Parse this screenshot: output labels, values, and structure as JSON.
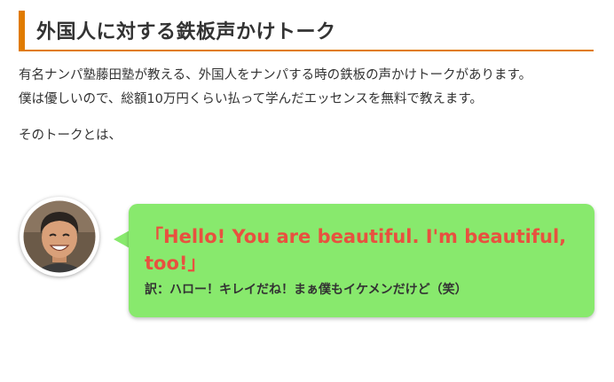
{
  "section": {
    "heading": "外国人に対する鉄板声かけトーク",
    "accent_color": "#e07b00"
  },
  "body": {
    "paragraph1_line1": "有名ナンパ塾藤田塾が教える、外国人をナンパする時の鉄板の声かけトークがあります。",
    "paragraph1_line2": "僕は優しいので、総額10万円くらい払って学んだエッセンスを無料で教えます。",
    "paragraph2": "そのトークとは、"
  },
  "speech": {
    "quote": "「Hello! You are beautiful. I'm beautiful, too!」",
    "translation": "訳：ハロー！キレイだね！まぁ僕もイケメンだけど（笑）",
    "bubble_color": "#88e96d",
    "quote_color": "#e8513f"
  }
}
